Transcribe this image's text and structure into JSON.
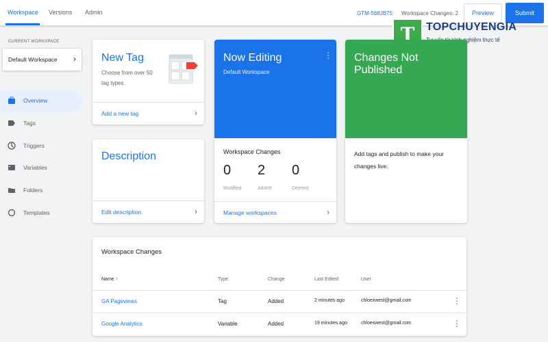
{
  "topbar": {
    "tabs": [
      {
        "label": "Workspace",
        "active": true
      },
      {
        "label": "Versions",
        "active": false
      },
      {
        "label": "Admin",
        "active": false
      }
    ],
    "container_id": "GTM-568JB75",
    "workspace_changes": "Workspace Changes: 2",
    "preview_label": "Preview",
    "submit_label": "Submit"
  },
  "watermark": {
    "logo_letter": "T",
    "title": "TOPCHUYENGIA",
    "subtitle": "Tư vấn từ kinh nghiệm thực tế"
  },
  "sidebar": {
    "current_workspace_label": "CURRENT WORKSPACE",
    "workspace_name": "Default Workspace",
    "items": [
      {
        "label": "Overview",
        "icon": "briefcase-icon",
        "active": true
      },
      {
        "label": "Tags",
        "icon": "tag-icon",
        "active": false
      },
      {
        "label": "Triggers",
        "icon": "trigger-icon",
        "active": false
      },
      {
        "label": "Variables",
        "icon": "variables-icon",
        "active": false
      },
      {
        "label": "Folders",
        "icon": "folder-icon",
        "active": false
      },
      {
        "label": "Templates",
        "icon": "templates-icon",
        "active": false
      }
    ]
  },
  "cards": {
    "new_tag": {
      "title": "New Tag",
      "subtitle_line1": "Choose from over 50",
      "subtitle_line2": "tag types",
      "link": "Add a new tag"
    },
    "now_editing": {
      "title": "Now Editing",
      "subtitle": "Default Workspace",
      "section_title": "Workspace Changes",
      "stats": [
        {
          "value": "0",
          "label": "Modified"
        },
        {
          "value": "2",
          "label": "Added"
        },
        {
          "value": "0",
          "label": "Deleted"
        }
      ],
      "link": "Manage workspaces"
    },
    "changes_not_published": {
      "title": "Changes Not Published",
      "body_line1": "Add tags and publish to make your",
      "body_line2": "changes live."
    },
    "description": {
      "title": "Description",
      "link": "Edit description"
    }
  },
  "workspace_table": {
    "title": "Workspace Changes",
    "headers": {
      "name": "Name ↑",
      "type": "Type",
      "change": "Change",
      "last_edited": "Last Edited",
      "user": "User"
    },
    "rows": [
      {
        "name": "GA Pageviews",
        "type": "Tag",
        "change": "Added",
        "last_edited": "2 minutes ago",
        "user": "chloexwest@gmail.com"
      },
      {
        "name": "Google Analytics",
        "type": "Variable",
        "change": "Added",
        "last_edited": "19 minutes ago",
        "user": "chloexwest@gmail.com"
      }
    ]
  },
  "colors": {
    "accent": "#1a73e8",
    "published_green": "#34a853",
    "watermark_green": "#3daa4c",
    "watermark_navy": "#1e3a8a"
  }
}
